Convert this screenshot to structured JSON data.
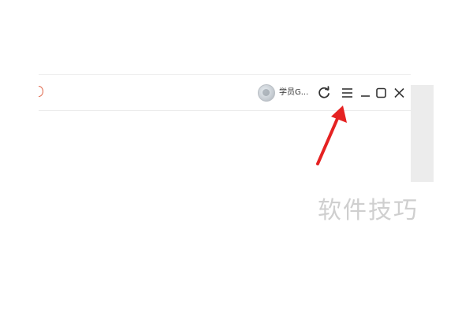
{
  "titlebar": {
    "user": {
      "avatar_icon": "user-avatar-icon",
      "name": "学员G..."
    },
    "controls": {
      "refresh_icon": "refresh-icon",
      "menu_icon": "hamburger-menu-icon",
      "minimize_icon": "minimize-icon",
      "maximize_icon": "maximize-icon",
      "close_icon": "close-icon"
    }
  },
  "annotation": {
    "arrow_icon": "red-pointer-arrow-icon",
    "arrow_color": "#e52222"
  },
  "watermark": {
    "text": "软件技巧"
  }
}
